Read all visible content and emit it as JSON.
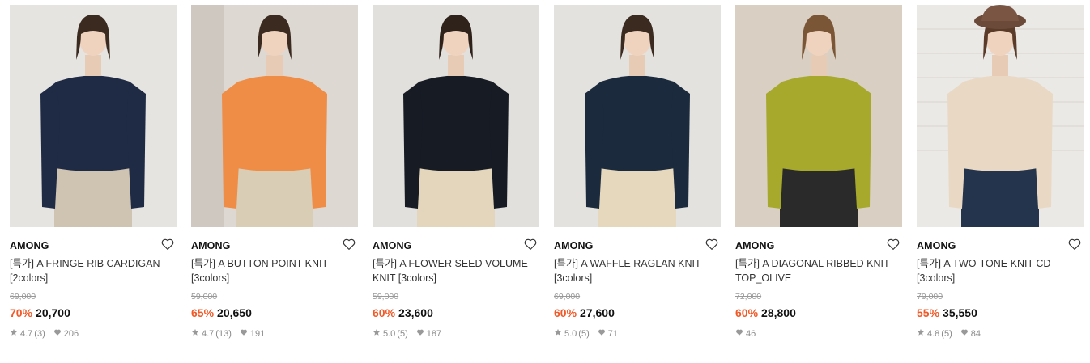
{
  "colors": {
    "discount": "#f05a28",
    "strike": "#999999",
    "meta": "#888888"
  },
  "products": [
    {
      "brand": "AMONG",
      "name_line1": "[특가] A FRINGE RIB CARDIGAN",
      "name_line2": "[2colors]",
      "original_price": "69,000",
      "discount": "70%",
      "price": "20,700",
      "rating": "4.7",
      "reviews": "(3)",
      "likes": "206",
      "garment_color": "#1f2b45",
      "bottom_color": "#cfc3b2",
      "bg_color": "#e6e4e1"
    },
    {
      "brand": "AMONG",
      "name_line1": "[특가] A BUTTON POINT KNIT",
      "name_line2": "[3colors]",
      "original_price": "59,000",
      "discount": "65%",
      "price": "20,650",
      "rating": "4.7",
      "reviews": "(13)",
      "likes": "191",
      "garment_color": "#ef8c46",
      "bottom_color": "#d9cdb6",
      "bg_color": "#ddd8d2"
    },
    {
      "brand": "AMONG",
      "name_line1": "[특가] A FLOWER SEED VOLUME",
      "name_line2": "KNIT [3colors]",
      "original_price": "59,000",
      "discount": "60%",
      "price": "23,600",
      "rating": "5.0",
      "reviews": "(5)",
      "likes": "187",
      "garment_color": "#171b24",
      "bottom_color": "#e3d6bc",
      "bg_color": "#e2e0dc"
    },
    {
      "brand": "AMONG",
      "name_line1": "[특가] A WAFFLE RAGLAN KNIT",
      "name_line2": "[3colors]",
      "original_price": "69,000",
      "discount": "60%",
      "price": "27,600",
      "rating": "5.0",
      "reviews": "(5)",
      "likes": "71",
      "garment_color": "#1b2a3c",
      "bottom_color": "#e6d8bd",
      "bg_color": "#e4e2df"
    },
    {
      "brand": "AMONG",
      "name_line1": "[특가] A DIAGONAL RIBBED KNIT",
      "name_line2": "TOP_OLIVE",
      "original_price": "72,000",
      "discount": "60%",
      "price": "28,800",
      "rating": "",
      "reviews": "",
      "likes": "46",
      "garment_color": "#a6a92c",
      "bottom_color": "#2a2a2a",
      "bg_color": "#d9cfc2"
    },
    {
      "brand": "AMONG",
      "name_line1": "[특가] A TWO-TONE KNIT CD",
      "name_line2": "[3colors]",
      "original_price": "79,000",
      "discount": "55%",
      "price": "35,550",
      "rating": "4.8",
      "reviews": "(5)",
      "likes": "84",
      "garment_color": "#e9d9c4",
      "bottom_color": "#24344c",
      "bg_color": "#ebe9e6"
    }
  ]
}
